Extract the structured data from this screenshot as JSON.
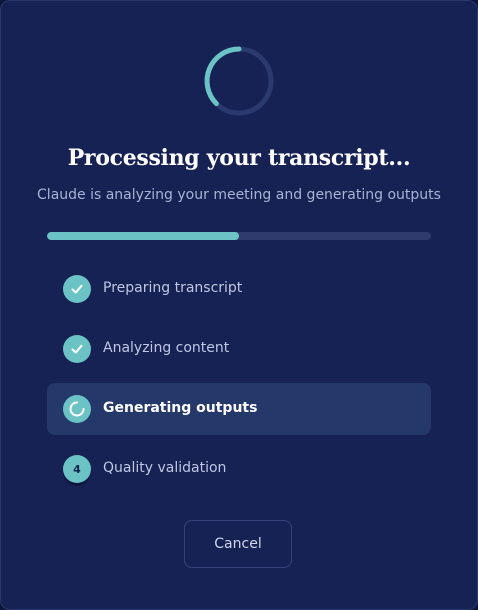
{
  "dialog": {
    "title": "Processing your transcript...",
    "subtitle": "Claude is analyzing your meeting and generating outputs",
    "progress_fraction": 0.5
  },
  "steps": [
    {
      "label": "Preparing transcript",
      "status": "complete",
      "icon": "check-icon"
    },
    {
      "label": "Analyzing content",
      "status": "complete",
      "icon": "check-icon"
    },
    {
      "label": "Generating outputs",
      "status": "in-progress",
      "icon": "spinner-icon"
    },
    {
      "label": "Quality validation",
      "status": "pending",
      "number": "4"
    }
  ],
  "actions": {
    "cancel_label": "Cancel"
  },
  "colors": {
    "accent": "#6bc3c6",
    "background": "#162253",
    "active_row": "#24386a",
    "track": "#2e3b6c"
  }
}
